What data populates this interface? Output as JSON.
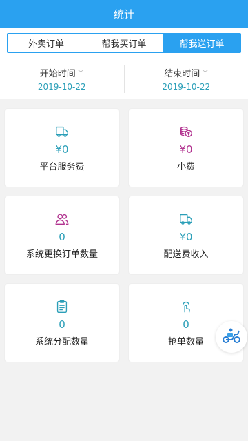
{
  "header": {
    "title": "统计"
  },
  "tabs": [
    {
      "label": "外卖订单",
      "active": false
    },
    {
      "label": "帮我买订单",
      "active": false
    },
    {
      "label": "帮我送订单",
      "active": true
    }
  ],
  "dates": {
    "start": {
      "label": "开始时间",
      "value": "2019-10-22"
    },
    "end": {
      "label": "结束时间",
      "value": "2019-10-22"
    }
  },
  "cards": [
    {
      "value": "¥0",
      "label": "平台服务费",
      "icon": "delivery-truck-icon",
      "color": "#2b9fb8"
    },
    {
      "value": "¥0",
      "label": "小费",
      "icon": "coin-stack-icon",
      "color": "#b1328f"
    },
    {
      "value": "0",
      "label": "系统更换订单数量",
      "icon": "users-icon",
      "color": "#b1328f"
    },
    {
      "value": "¥0",
      "label": "配送费收入",
      "icon": "delivery-truck-icon",
      "color": "#2b9fb8"
    },
    {
      "value": "0",
      "label": "系统分配数量",
      "icon": "clipboard-icon",
      "color": "#2b9fb8"
    },
    {
      "value": "0",
      "label": "抢单数量",
      "icon": "tap-finger-icon",
      "color": "#2b9fb8"
    }
  ],
  "colors": {
    "brand": "#2aa1f0",
    "teal": "#2b9fb8",
    "magenta": "#b1328f"
  }
}
